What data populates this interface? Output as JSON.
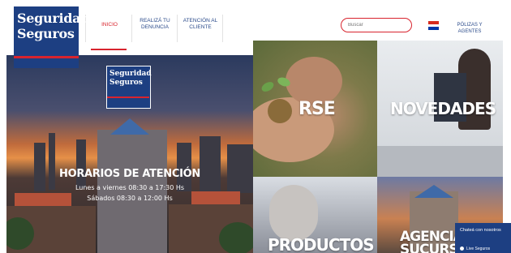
{
  "header": {
    "logo": {
      "line1": "Seguridad",
      "line2": "Seguros"
    },
    "nav": [
      {
        "label": "INICIO"
      },
      {
        "label": "REALIZÁ TU DENUNCIA"
      },
      {
        "label": "ATENCIÓN AL CLIENTE"
      }
    ],
    "search": {
      "placeholder": "Buscar"
    },
    "polizas": "PÓLIZAS Y AGENTES"
  },
  "hero": {
    "logo": {
      "line1": "Seguridad",
      "line2": "Seguros"
    },
    "title": "HORARIOS DE ATENCIÓN",
    "line1": "Lunes a viernes 08:30 a 17:30 Hs",
    "line2": "Sábados 08:30 a 12:00 Hs"
  },
  "tiles": {
    "rse": "RSE",
    "novedades": "NOVEDADES",
    "productos": "PRODUCTOS",
    "agencias": "AGENCIAS Y SUCURSALES"
  },
  "chat": {
    "line1": "Chateá con nosotros",
    "line2": "Live Seguros"
  },
  "colors": {
    "brand_blue": "#1d3f82",
    "accent_red": "#d8242e"
  }
}
